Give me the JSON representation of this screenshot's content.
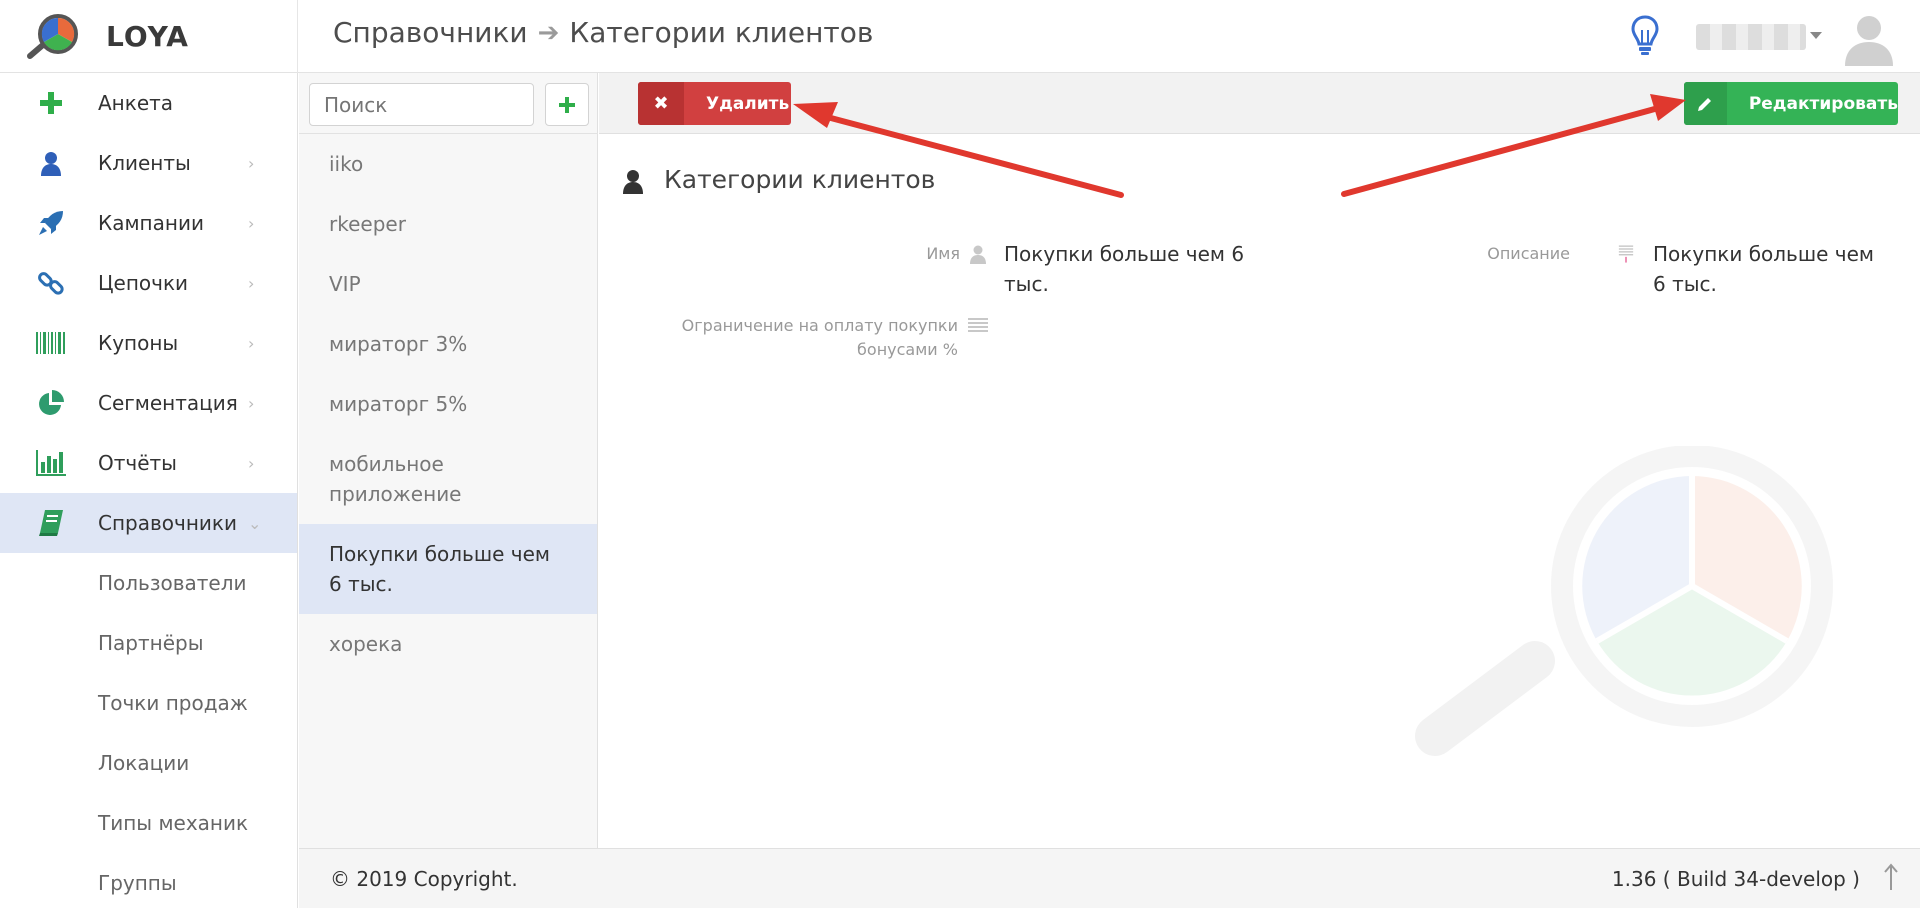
{
  "app": {
    "name": "LOYA"
  },
  "breadcrumb": {
    "parent": "Справочники",
    "separator": "➔",
    "current": "Категории клиентов"
  },
  "sidebar": {
    "items": [
      {
        "label": "Анкета",
        "icon": "plus-icon",
        "chevron": ""
      },
      {
        "label": "Клиенты",
        "icon": "user-icon",
        "chevron": "›"
      },
      {
        "label": "Кампании",
        "icon": "rocket-icon",
        "chevron": "›"
      },
      {
        "label": "Цепочки",
        "icon": "chain-icon",
        "chevron": "›"
      },
      {
        "label": "Купоны",
        "icon": "barcode-icon",
        "chevron": "›"
      },
      {
        "label": "Сегментация",
        "icon": "pie-chart-icon",
        "chevron": "›"
      },
      {
        "label": "Отчёты",
        "icon": "bar-chart-icon",
        "chevron": "›"
      },
      {
        "label": "Справочники",
        "icon": "book-icon",
        "chevron": "⌄"
      }
    ],
    "subitems": [
      "Пользователи",
      "Партнёры",
      "Точки продаж",
      "Локации",
      "Типы механик",
      "Группы"
    ]
  },
  "list": {
    "search_placeholder": "Поиск",
    "add_label": "+",
    "items": [
      {
        "text": "iiko"
      },
      {
        "text": "rkeeper"
      },
      {
        "text": "VIP"
      },
      {
        "text": "мираторг 3%"
      },
      {
        "text": "мираторг 5%"
      },
      {
        "text": "мобильное приложение"
      },
      {
        "text": "Покупки больше чем 6 тыс."
      },
      {
        "text": "хорека"
      }
    ],
    "selected_index": 6
  },
  "toolbar": {
    "delete_label": "Удалить",
    "delete_icon": "✖",
    "edit_label": "Редактировать",
    "edit_icon": "pencil-icon"
  },
  "detail": {
    "title": "Категории клиентов",
    "fields": {
      "name_label": "Имя",
      "name_value": "Покупки больше чем 6 тыс.",
      "description_label": "Описание",
      "description_value": "Покупки больше чем 6 тыс.",
      "limit_label": "Ограничение на оплату покупки бонусами %"
    }
  },
  "footer": {
    "copyright": "© 2019 Copyright.",
    "version": "1.36 ( Build 34-develop )"
  },
  "colors": {
    "delete": "#d14040",
    "edit": "#34b356",
    "active_bg": "#dfe6f5",
    "annotation": "#e0382e"
  }
}
